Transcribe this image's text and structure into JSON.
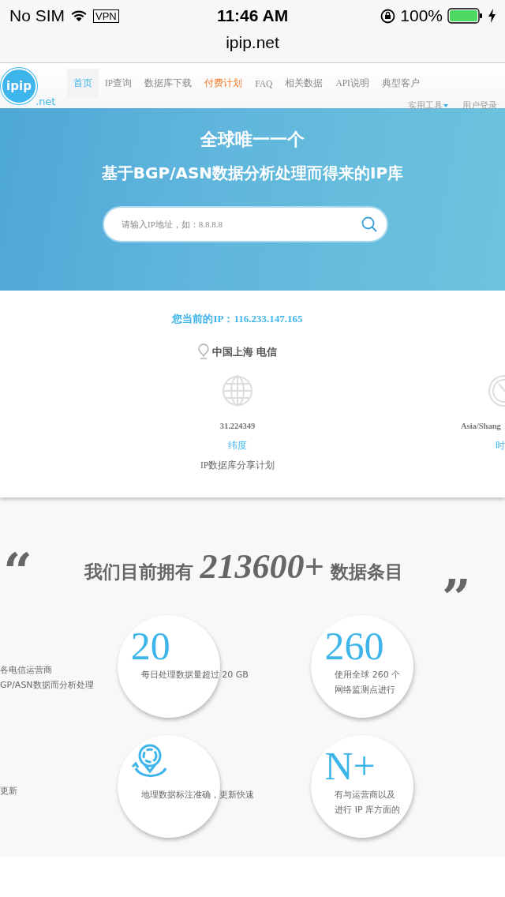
{
  "status_bar": {
    "carrier": "No SIM",
    "vpn": "VPN",
    "time": "11:46 AM",
    "battery": "100%"
  },
  "address_bar": {
    "url": "ipip.net"
  },
  "header": {
    "logo": "ipip",
    "logo_suffix": ".net",
    "nav": [
      {
        "label": "首页",
        "selected": true,
        "kind": "normal"
      },
      {
        "label": "IP查询",
        "selected": false,
        "kind": "normal"
      },
      {
        "label": "数据库下载",
        "selected": false,
        "kind": "normal"
      },
      {
        "label": "付费计划",
        "selected": false,
        "kind": "highlight"
      },
      {
        "label": "FAQ",
        "selected": false,
        "kind": "normal"
      },
      {
        "label": "相关数据",
        "selected": false,
        "kind": "normal"
      },
      {
        "label": "API说明",
        "selected": false,
        "kind": "normal"
      },
      {
        "label": "典型客户",
        "selected": false,
        "kind": "normal"
      }
    ],
    "nav_secondary": [
      {
        "label": "实用工具",
        "dropdown": true
      },
      {
        "label": "用户登录",
        "dropdown": false
      }
    ]
  },
  "hero": {
    "title": "全球唯一一个",
    "subtitle": "基于BGP/ASN数据分析处理而得来的IP库",
    "search": {
      "placeholder": "请输入IP地址，如：8.8.8.8"
    }
  },
  "ip_info": {
    "current_ip": "您当前的IP：116.233.147.165",
    "location": "中国上海 电信",
    "details": [
      {
        "kind": "globe",
        "value": "31.224349",
        "label": "纬度"
      },
      {
        "kind": "clock",
        "value": "Asia/Shang",
        "label": "时"
      }
    ],
    "share_link": "IP数据库分享计划"
  },
  "stats": {
    "open_quote": "“",
    "heading_prefix": "我们目前拥有",
    "count": "213600+",
    "heading_suffix": "数据条目",
    "close_quote": "”",
    "left_lines": [
      [
        "各电信运营商",
        "GP/ASN数据而分析处理"
      ],
      [
        "更新"
      ]
    ],
    "rows": [
      [
        {
          "kind": "number",
          "number": "20",
          "lines": [
            "每日处理数据量超过 20 GB"
          ]
        },
        {
          "kind": "number",
          "number": "260",
          "lines": [
            "使用全球 260 个",
            "网络监测点进行"
          ]
        }
      ],
      [
        {
          "kind": "pin",
          "lines": [
            "地理数据标注准确，更新快速"
          ]
        },
        {
          "kind": "number",
          "number": "N+",
          "lines": [
            "有与运营商以及",
            "进行 IP 库方面的"
          ]
        }
      ]
    ]
  }
}
